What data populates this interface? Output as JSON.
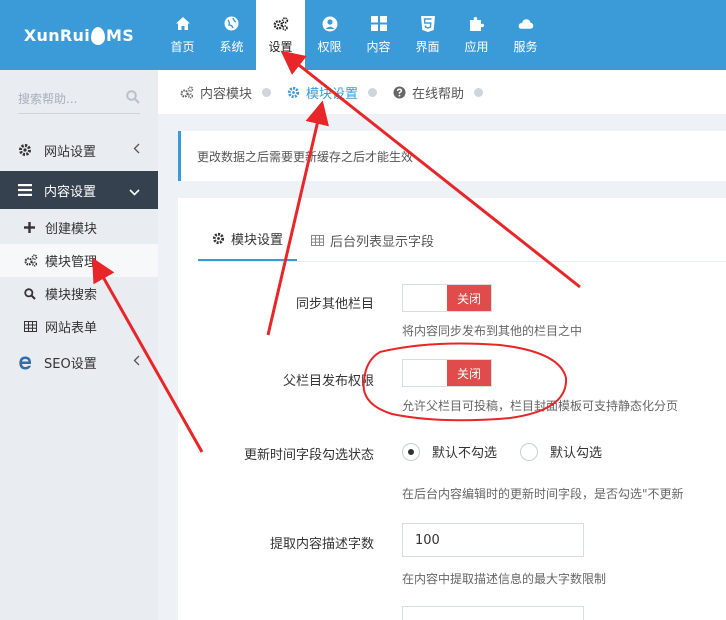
{
  "brand": {
    "logo_left": "XunRui",
    "logo_right": "MS"
  },
  "topnav": {
    "items": [
      {
        "label": "首页",
        "icon": "home-icon"
      },
      {
        "label": "系统",
        "icon": "globe-icon"
      },
      {
        "label": "设置",
        "icon": "gears-icon",
        "active": true
      },
      {
        "label": "权限",
        "icon": "user-circle-icon"
      },
      {
        "label": "内容",
        "icon": "grid-icon"
      },
      {
        "label": "界面",
        "icon": "html5-icon"
      },
      {
        "label": "应用",
        "icon": "puzzle-icon"
      },
      {
        "label": "服务",
        "icon": "cloud-icon"
      }
    ]
  },
  "sidebar": {
    "search_placeholder": "搜索帮助...",
    "menu": {
      "site_settings": "网站设置",
      "content_settings": "内容设置",
      "create_module": "创建模块",
      "module_manage": "模块管理",
      "module_search": "模块搜索",
      "site_form": "网站表单",
      "seo_settings": "SEO设置"
    }
  },
  "breadcrumb": {
    "items": [
      "内容模块",
      "模块设置",
      "在线帮助"
    ]
  },
  "note": "更改数据之后需要更新缓存之后才能生效",
  "tabs": {
    "module_settings": "模块设置",
    "list_fields": "后台列表显示字段"
  },
  "form": {
    "sync_label": "同步其他栏目",
    "sync_state": "关闭",
    "sync_help": "将内容同步发布到其他的栏目之中",
    "parent_label": "父栏目发布权限",
    "parent_state": "关闭",
    "parent_help": "允许父栏目可投稿，栏目封面模板可支持静态化分页",
    "update_time_label": "更新时间字段勾选状态",
    "radio_unchecked": "默认不勾选",
    "radio_checked": "默认勾选",
    "update_time_help": "在后台内容编辑时的更新时间字段，是否勾选\"不更新",
    "desc_len_label": "提取内容描述字数",
    "desc_len_value": "100",
    "desc_len_help": "在内容中提取描述信息的最大字数限制"
  },
  "colors": {
    "accent": "#3b9bd8",
    "danger": "#e04b4b",
    "annotation": "#e8262a",
    "sidebar_dark": "#364150"
  }
}
